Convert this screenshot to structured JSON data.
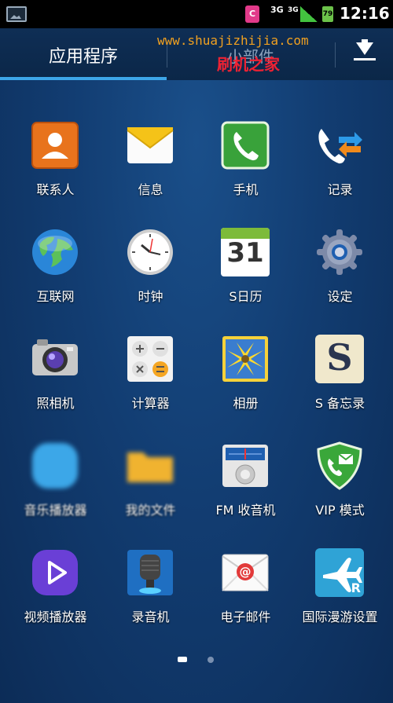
{
  "status_bar": {
    "gallery_icon": "gallery-icon",
    "sim_label": "C",
    "net1": "3G",
    "net2": "3G",
    "battery": "79",
    "time": "12:16"
  },
  "tabs": {
    "apps_label": "应用程序",
    "widgets_label": "小部件",
    "download_icon": "download-icon"
  },
  "watermark": {
    "url": "www.shuajizhijia.com",
    "title": "刷机之家"
  },
  "apps": [
    {
      "label": "联系人",
      "icon": "contacts-icon"
    },
    {
      "label": "信息",
      "icon": "messages-icon"
    },
    {
      "label": "手机",
      "icon": "phone-icon"
    },
    {
      "label": "记录",
      "icon": "call-log-icon"
    },
    {
      "label": "互联网",
      "icon": "internet-icon"
    },
    {
      "label": "时钟",
      "icon": "clock-icon"
    },
    {
      "label": "S日历",
      "icon": "calendar-icon",
      "day": "31"
    },
    {
      "label": "设定",
      "icon": "settings-icon"
    },
    {
      "label": "照相机",
      "icon": "camera-icon"
    },
    {
      "label": "计算器",
      "icon": "calculator-icon"
    },
    {
      "label": "相册",
      "icon": "gallery-icon"
    },
    {
      "label": "S 备忘录",
      "icon": "memo-icon",
      "letter": "S"
    },
    {
      "label": "音乐播放器",
      "icon": "music-player-icon"
    },
    {
      "label": "我的文件",
      "icon": "my-files-icon"
    },
    {
      "label": "FM 收音机",
      "icon": "fm-radio-icon"
    },
    {
      "label": "VIP 模式",
      "icon": "vip-mode-icon"
    },
    {
      "label": "视频播放器",
      "icon": "video-player-icon"
    },
    {
      "label": "录音机",
      "icon": "voice-recorder-icon"
    },
    {
      "label": "电子邮件",
      "icon": "email-icon"
    },
    {
      "label": "国际漫游设置",
      "icon": "roaming-icon",
      "letter": "R"
    }
  ],
  "page_indicator": {
    "current": 1,
    "total": 2
  },
  "colors": {
    "accent": "#3da6e8",
    "background": "#123d72"
  }
}
